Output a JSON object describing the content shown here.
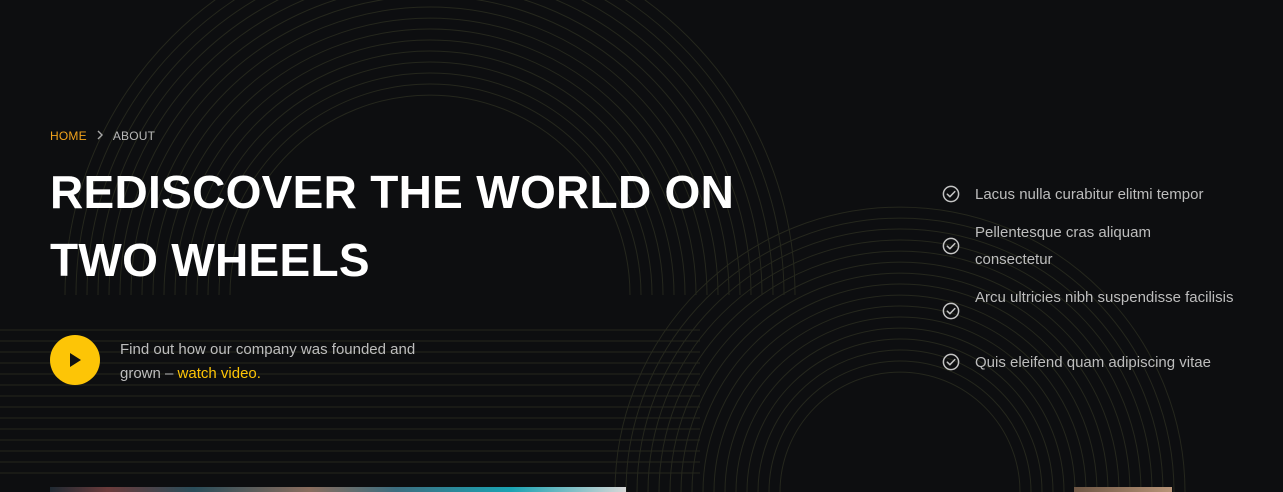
{
  "breadcrumb": {
    "home": "HOME",
    "separator_icon": "chevron-right-icon",
    "current": "ABOUT"
  },
  "hero": {
    "title_line1": "REDISCOVER THE WORLD ON",
    "title_line2": "TWO WHEELS",
    "video_text": "Find out how our company was founded and grown –",
    "video_link": "watch video."
  },
  "features": [
    "Lacus nulla curabitur elitmi tempor",
    "Pellentesque cras aliquam consectetur",
    "Arcu ultricies nibh suspendisse facilisis",
    "Quis eleifend quam adipiscing vitae"
  ],
  "colors": {
    "background": "#0d0e10",
    "accent": "#fdc506",
    "breadcrumb_home": "#f2a31b",
    "text_muted": "#bdbdbd",
    "title": "#ffffff"
  },
  "icons": {
    "play": "play-icon",
    "check": "check-circle-icon"
  }
}
